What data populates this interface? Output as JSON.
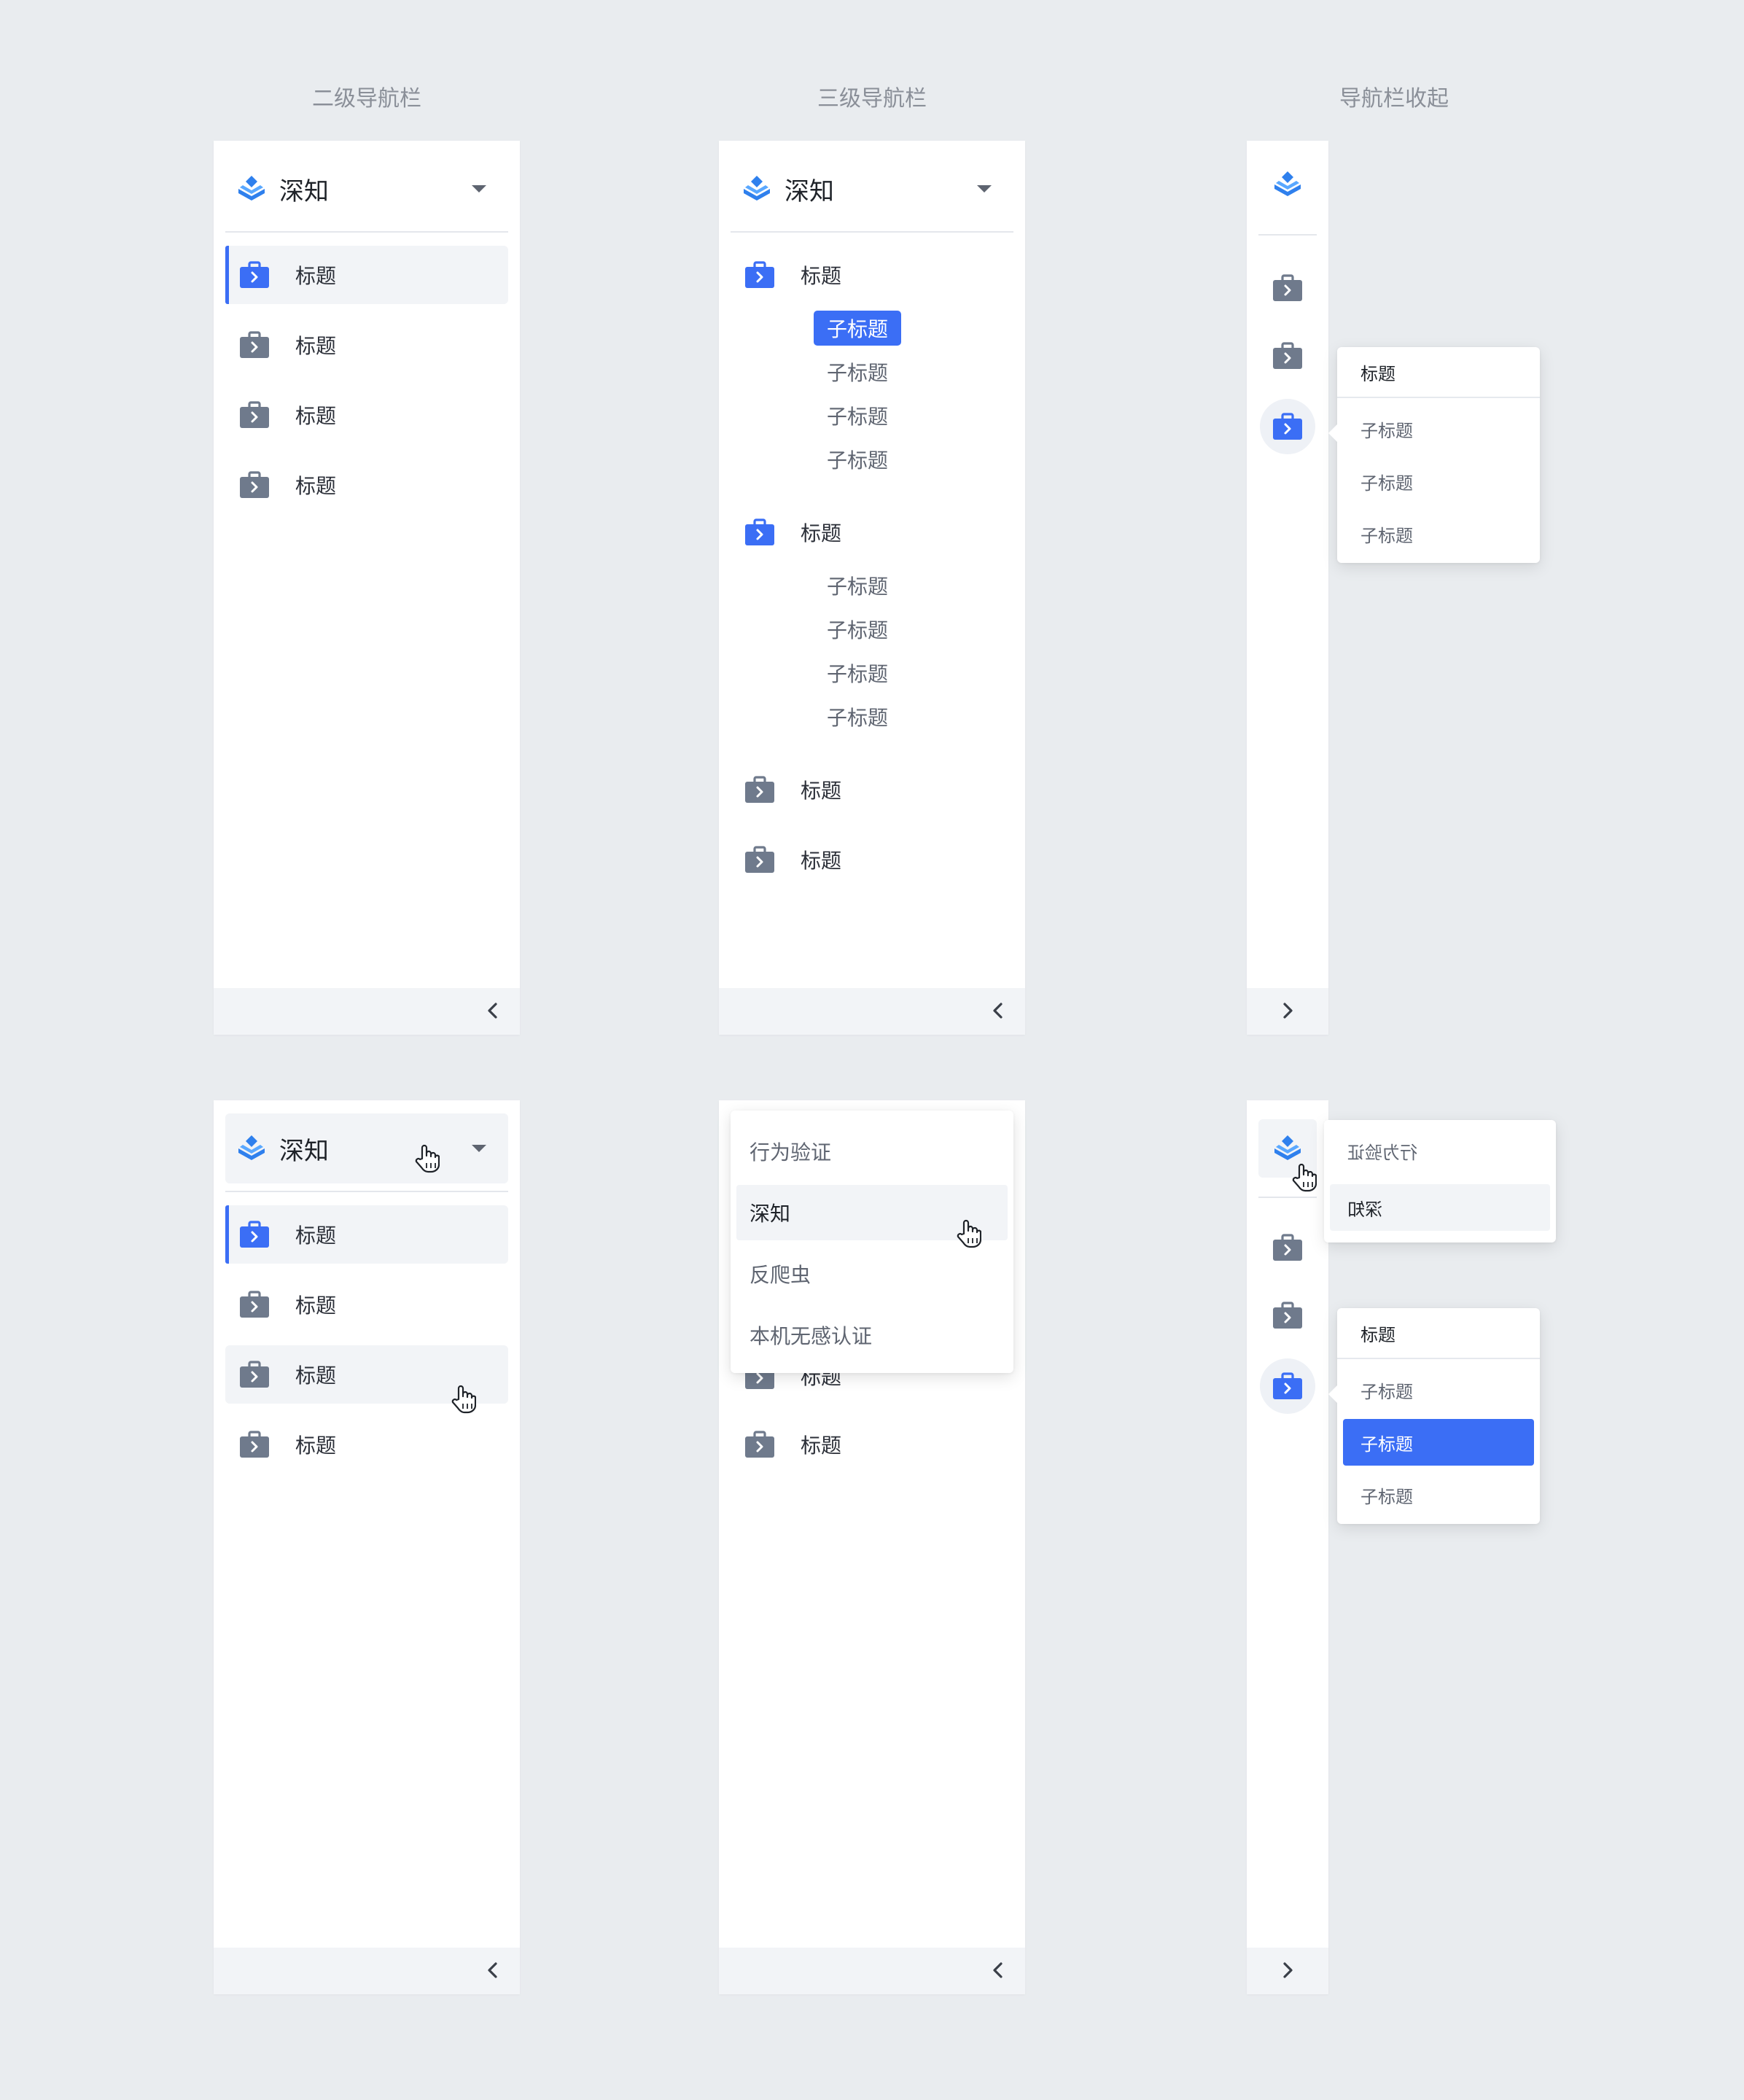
{
  "column_titles": [
    "二级导航栏",
    "三级导航栏",
    "导航栏收起"
  ],
  "brand": {
    "name": "深知"
  },
  "nav_item": "标题",
  "sub_item": "子标题",
  "colors": {
    "accent": "#3b6ef5",
    "icon_gray": "#6f7a8c",
    "background": "#e9ecef",
    "hover_bg": "#f2f4f7"
  },
  "icons": {
    "logo": "layers-icon",
    "nav": "briefcase-icon",
    "collapse": "chevron-left-icon",
    "expand": "chevron-right-icon",
    "dropdown": "caret-down-icon",
    "cursor": "hand-pointer-icon"
  },
  "dropdown_options": [
    "行为验证",
    "深知",
    "反爬虫",
    "本机无感认证"
  ],
  "hidden_behind_dropdown": "标题",
  "collapsed_product_menu": [
    "行为验证",
    "深知"
  ]
}
